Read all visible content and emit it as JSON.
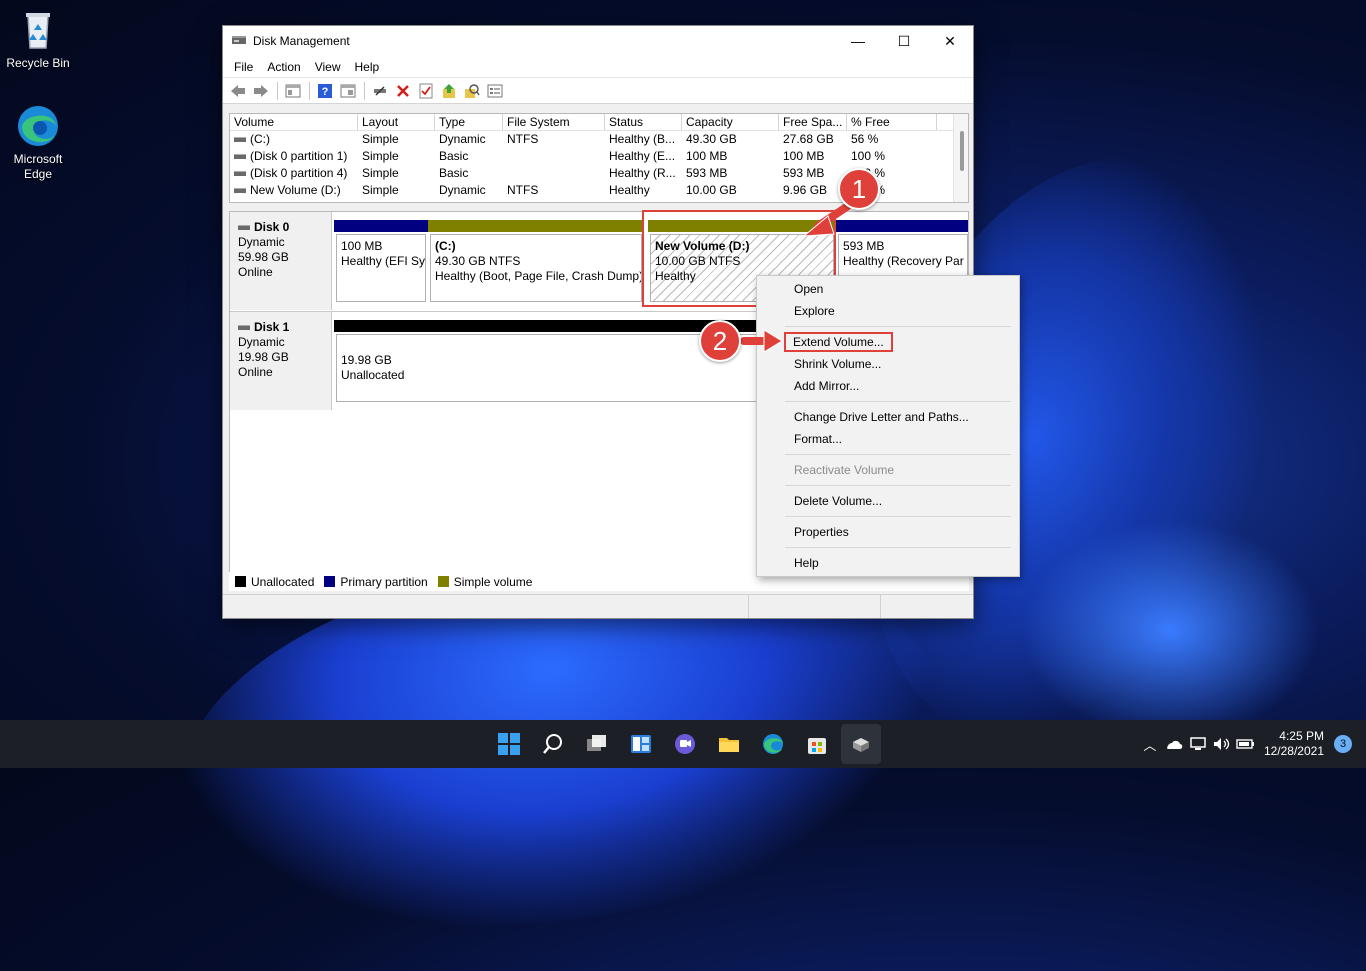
{
  "desktop": {
    "icons": [
      {
        "label": "Recycle Bin"
      },
      {
        "label": "Microsoft Edge"
      }
    ]
  },
  "window": {
    "title": "Disk Management",
    "controls": {
      "minimize": "—",
      "maximize": "☐",
      "close": "✕"
    },
    "menu": [
      "File",
      "Action",
      "View",
      "Help"
    ],
    "toolbar_icons": [
      "back-icon",
      "forward-icon",
      "properties-icon",
      "help-icon",
      "console-icon",
      "connect-icon",
      "delete-icon",
      "check-icon",
      "up-icon",
      "search-icon",
      "settings-icon"
    ]
  },
  "volume_list": {
    "columns": [
      "Volume",
      "Layout",
      "Type",
      "File System",
      "Status",
      "Capacity",
      "Free Spa...",
      "% Free"
    ],
    "rows": [
      [
        "(C:)",
        "Simple",
        "Dynamic",
        "NTFS",
        "Healthy (B...",
        "49.30 GB",
        "27.68 GB",
        "56 %"
      ],
      [
        "(Disk 0 partition 1)",
        "Simple",
        "Basic",
        "",
        "Healthy (E...",
        "100 MB",
        "100 MB",
        "100 %"
      ],
      [
        "(Disk 0 partition 4)",
        "Simple",
        "Basic",
        "",
        "Healthy (R...",
        "593 MB",
        "593 MB",
        "100 %"
      ],
      [
        "New Volume (D:)",
        "Simple",
        "Dynamic",
        "NTFS",
        "Healthy",
        "10.00 GB",
        "9.96 GB",
        "100 %"
      ]
    ]
  },
  "disks": [
    {
      "name": "Disk 0",
      "type": "Dynamic",
      "size": "59.98 GB",
      "state": "Online",
      "partitions": [
        {
          "title": "",
          "line1": "100 MB",
          "line2": "Healthy (EFI Sy"
        },
        {
          "title": "(C:)",
          "line1": "49.30 GB NTFS",
          "line2": "Healthy (Boot, Page File, Crash Dump)"
        },
        {
          "title": "New Volume  (D:)",
          "line1": "10.00 GB NTFS",
          "line2": "Healthy"
        },
        {
          "title": "",
          "line1": "593 MB",
          "line2": "Healthy (Recovery Par"
        }
      ]
    },
    {
      "name": "Disk 1",
      "type": "Dynamic",
      "size": "19.98 GB",
      "state": "Online",
      "partitions": [
        {
          "title": "",
          "line1": "19.98 GB",
          "line2": "Unallocated"
        }
      ]
    }
  ],
  "legend": [
    {
      "label": "Unallocated",
      "color": "#000000"
    },
    {
      "label": "Primary partition",
      "color": "#000080"
    },
    {
      "label": "Simple volume",
      "color": "#808000"
    }
  ],
  "context_menu": {
    "items": [
      "Open",
      "Explore",
      "Extend Volume...",
      "Shrink Volume...",
      "Add Mirror...",
      "Change Drive Letter and Paths...",
      "Format...",
      "Reactivate Volume",
      "Delete Volume...",
      "Properties",
      "Help"
    ]
  },
  "annotations": {
    "step1": "1",
    "step2": "2",
    "accent": "#e0403a"
  },
  "taskbar": {
    "apps": [
      "start-icon",
      "search-icon",
      "task-view-icon",
      "widgets-icon",
      "chat-icon",
      "file-explorer-icon",
      "edge-icon",
      "store-icon",
      "disk-management-icon"
    ],
    "tray_icons": [
      "chevron-up-icon",
      "onedrive-icon",
      "network-icon",
      "volume-icon",
      "battery-icon"
    ],
    "time": "4:25 PM",
    "date": "12/28/2021",
    "notifications": "3"
  }
}
